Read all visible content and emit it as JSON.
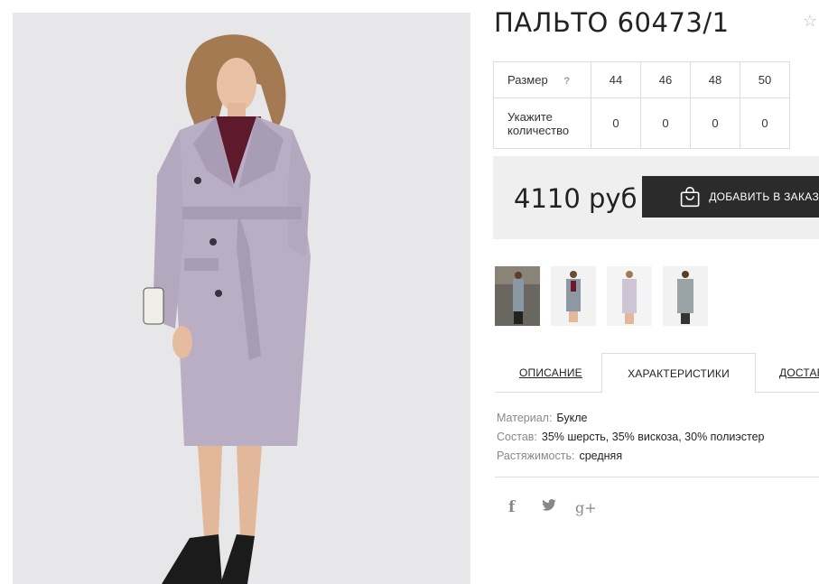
{
  "product": {
    "title": "ПАЛЬТО 60473/1"
  },
  "sizes": {
    "size_label": "Размер",
    "help": "?",
    "values": [
      "44",
      "46",
      "48",
      "50"
    ],
    "qty_label": "Укажите количество",
    "quantities": [
      "0",
      "0",
      "0",
      "0"
    ]
  },
  "price": {
    "amount": "4110 руб",
    "add_button": "ДОБАВИТЬ В ЗАКАЗ"
  },
  "tabs": [
    "ОПИСАНИЕ",
    "ХАРАКТЕРИСТИКИ",
    "ДОСТАВКА"
  ],
  "specs": [
    {
      "key": "Материал:",
      "value": "Букле"
    },
    {
      "key": "Состав:",
      "value": "35% шерсть, 35% вискоза, 30% полиэстер"
    },
    {
      "key": "Растяжимость:",
      "value": "средняя"
    }
  ],
  "social": {
    "facebook": "f",
    "googleplus": "g+"
  },
  "icons": [
    "star-icon",
    "shopping-bag-icon",
    "facebook-icon",
    "twitter-icon",
    "google-plus-icon"
  ],
  "colors": {
    "button_bg": "#2b2b2b",
    "price_bg": "#efefef",
    "coat": "#b9aec3"
  }
}
